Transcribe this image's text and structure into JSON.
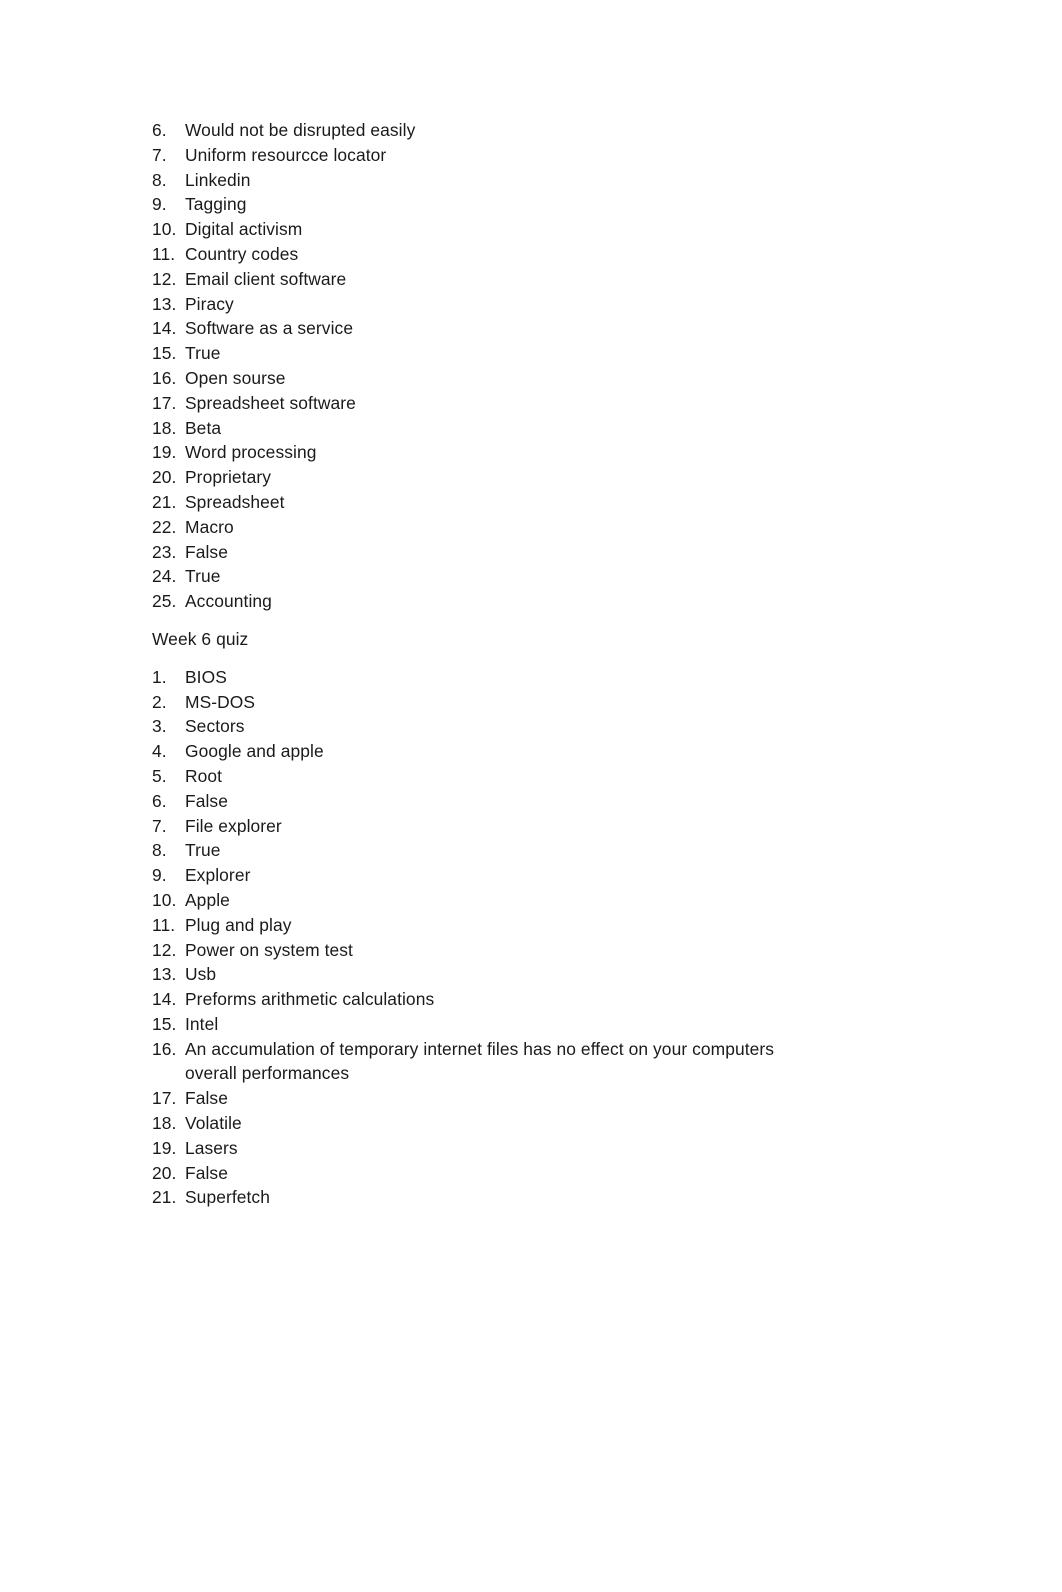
{
  "document": {
    "sections": [
      {
        "id": "week-5-answers-continued",
        "heading": null,
        "items": [
          {
            "number": "6.",
            "text": "Would not be disrupted easily"
          },
          {
            "number": "7.",
            "text": "Uniform resourcce locator"
          },
          {
            "number": "8.",
            "text": "Linkedin"
          },
          {
            "number": "9.",
            "text": "Tagging"
          },
          {
            "number": "10.",
            "text": "Digital activism"
          },
          {
            "number": "11.",
            "text": "Country codes"
          },
          {
            "number": "12.",
            "text": "Email client software"
          },
          {
            "number": "13.",
            "text": "Piracy"
          },
          {
            "number": "14.",
            "text": "Software as a service"
          },
          {
            "number": "15.",
            "text": "True"
          },
          {
            "number": "16.",
            "text": "Open sourse"
          },
          {
            "number": "17.",
            "text": "Spreadsheet software"
          },
          {
            "number": "18.",
            "text": "Beta"
          },
          {
            "number": "19.",
            "text": "Word processing"
          },
          {
            "number": "20.",
            "text": "Proprietary"
          },
          {
            "number": "21.",
            "text": "Spreadsheet"
          },
          {
            "number": "22.",
            "text": "Macro"
          },
          {
            "number": "23.",
            "text": "False"
          },
          {
            "number": "24.",
            "text": "True"
          },
          {
            "number": "25.",
            "text": "Accounting"
          }
        ]
      },
      {
        "id": "week-6-quiz",
        "heading": "Week 6 quiz",
        "items": [
          {
            "number": "1.",
            "text": "BIOS"
          },
          {
            "number": "2.",
            "text": "MS-DOS"
          },
          {
            "number": "3.",
            "text": "Sectors"
          },
          {
            "number": "4.",
            "text": "Google and apple"
          },
          {
            "number": "5.",
            "text": "Root"
          },
          {
            "number": "6.",
            "text": "False"
          },
          {
            "number": "7.",
            "text": "File explorer"
          },
          {
            "number": "8.",
            "text": "True"
          },
          {
            "number": "9.",
            "text": "Explorer"
          },
          {
            "number": "10.",
            "text": "Apple"
          },
          {
            "number": "11.",
            "text": "Plug and play"
          },
          {
            "number": "12.",
            "text": "Power on system test"
          },
          {
            "number": "13.",
            "text": "Usb"
          },
          {
            "number": "14.",
            "text": "Preforms arithmetic calculations"
          },
          {
            "number": "15.",
            "text": "Intel"
          },
          {
            "number": "16.",
            "text": "An accumulation of temporary internet files has no effect on your computers overall performances"
          },
          {
            "number": "17.",
            "text": "False"
          },
          {
            "number": "18.",
            "text": "Volatile"
          },
          {
            "number": "19.",
            "text": "Lasers"
          },
          {
            "number": "20.",
            "text": "False"
          },
          {
            "number": "21.",
            "text": "Superfetch"
          }
        ]
      }
    ]
  },
  "colors": {
    "page_background": "#ffffff",
    "text": "#1a1a1a"
  }
}
